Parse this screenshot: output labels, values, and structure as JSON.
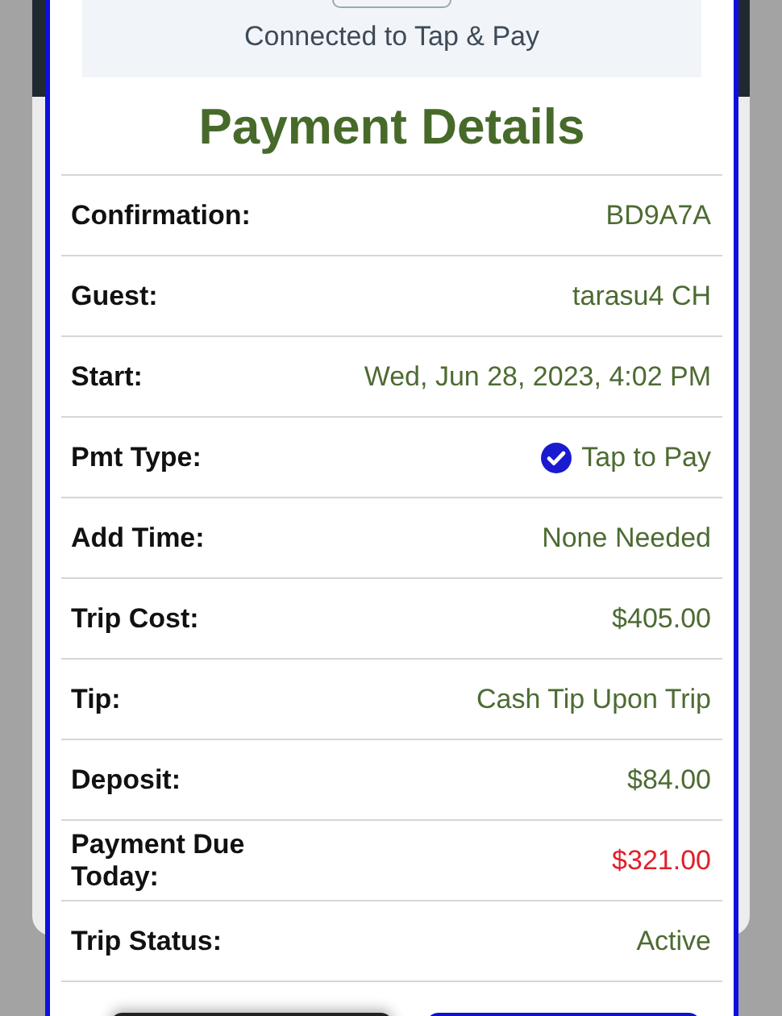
{
  "status_panel": {
    "message": "Connected to Tap & Pay"
  },
  "title": "Payment Details",
  "rows": [
    {
      "label": "Confirmation:",
      "value": "BD9A7A",
      "kind": "text",
      "color": "#4d6b32"
    },
    {
      "label": "Guest:",
      "value": "tarasu4 CH",
      "kind": "text",
      "color": "#4d6b32"
    },
    {
      "label": "Start:",
      "value": "Wed, Jun 28, 2023, 4:02 PM",
      "kind": "text",
      "color": "#4d6b32"
    },
    {
      "label": "Pmt Type:",
      "value": "Tap to Pay",
      "kind": "check",
      "color": "#4d6b32"
    },
    {
      "label": "Add Time:",
      "value": "None Needed",
      "kind": "text",
      "color": "#4d6b32"
    },
    {
      "label": "Trip Cost:",
      "value": "$405.00",
      "kind": "text",
      "color": "#4d6b32"
    },
    {
      "label": "Tip:",
      "value": "Cash Tip Upon Trip",
      "kind": "text",
      "color": "#4d6b32"
    },
    {
      "label": "Deposit:",
      "value": "$84.00",
      "kind": "text",
      "color": "#4d6b32"
    },
    {
      "label": "Payment Due Today:",
      "value": "$321.00",
      "kind": "text",
      "color": "#e0202a"
    },
    {
      "label": "Trip Status:",
      "value": "Active",
      "kind": "text",
      "color": "#4d6b32"
    }
  ],
  "buttons": [
    {
      "kind": "outline"
    },
    {
      "kind": "primary"
    }
  ]
}
